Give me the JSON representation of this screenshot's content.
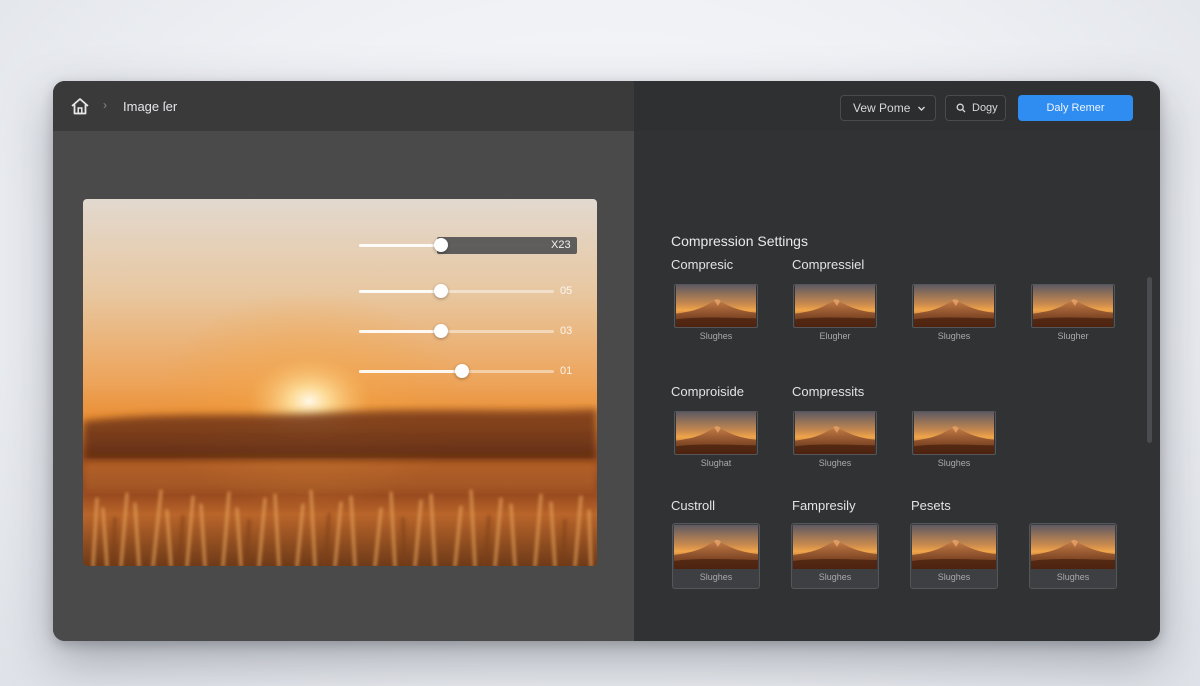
{
  "header": {
    "breadcrumb_title": "Image ſer",
    "view_button_label": "Vew Pome",
    "search_button_label": "Dogy",
    "primary_button_label": "Daly Remer"
  },
  "preview": {
    "sliders": [
      {
        "value_label": "X23",
        "level": 0.42,
        "active": true
      },
      {
        "value_label": "05",
        "level": 0.42
      },
      {
        "value_label": "03",
        "level": 0.42
      },
      {
        "value_label": "01",
        "level": 0.53
      }
    ]
  },
  "compression": {
    "title": "Compression Settings",
    "groups": [
      {
        "labels": [
          "Compresic",
          "Compressiel"
        ]
      },
      {
        "labels": [
          "Comproiside",
          "Compressits"
        ]
      },
      {
        "labels": [
          "Custroll",
          "Fampresily",
          "Pesets"
        ]
      }
    ],
    "thumbnails": [
      {
        "caption": "Slughes"
      },
      {
        "caption": "Elugher"
      },
      {
        "caption": "Slughes"
      },
      {
        "caption": "Slugher"
      },
      {
        "caption": "Slughat"
      },
      {
        "caption": "Slughes"
      },
      {
        "caption": "Slughes"
      },
      {
        "caption": "Slughes"
      },
      {
        "caption": "Slughes"
      },
      {
        "caption": "Slughes"
      },
      {
        "caption": "Slughes"
      }
    ]
  },
  "colors": {
    "accent": "#2f8cf0",
    "left_pane": "#4a4a4b",
    "right_pane": "#313234"
  },
  "icons": {
    "home": "home-icon",
    "chevron": "chevron-right-icon",
    "dropdown": "chevron-down-icon",
    "search": "search-icon"
  }
}
